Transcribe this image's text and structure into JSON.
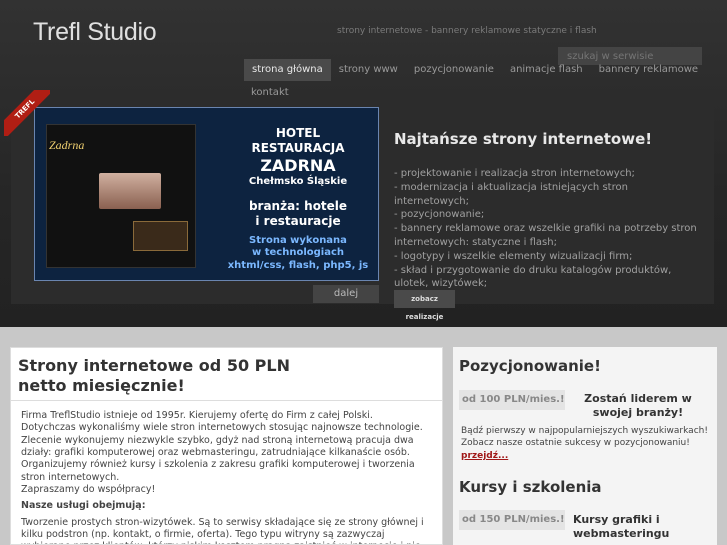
{
  "header": {
    "logo": "Trefl Studio",
    "tagline": "strony internetowe - bannery reklamowe statyczne i flash",
    "search_placeholder": "szukaj w serwisie"
  },
  "nav": {
    "items": [
      "strona główna",
      "strony www",
      "pozycjonowanie",
      "animacje flash",
      "bannery reklamowe"
    ],
    "contact": "kontakt",
    "active_index": 0
  },
  "ribbon": {
    "label": "TREFL"
  },
  "slider": {
    "screen_title": "Zadrna",
    "lines": [
      "HOTEL",
      "RESTAURACJA",
      "ZADRNA",
      "Chełmsko Śląskie",
      "branża: hotele",
      "i restauracje",
      "Strona wykonana",
      "w technologiach",
      "xhtml/css, flash, php5, js"
    ],
    "next_label": "dalej"
  },
  "promo": {
    "title": "Najtańsze strony internetowe!",
    "items": [
      "- projektowanie i realizacja stron internetowych;",
      "- modernizacja i aktualizacja istniejących stron internetowych;",
      "- pozycjonowanie;",
      "- bannery reklamowe oraz wszelkie grafiki na potrzeby stron internetowych: statyczne i flash;",
      "- logotypy i wszelkie elementy wizualizacji firm;",
      "- skład i przygotowanie do druku katalogów produktów, ulotek, wizytówek;"
    ],
    "see_label": "zobacz realizacje"
  },
  "main": {
    "title": "Strony internetowe od 50 PLN netto miesięcznie!",
    "intro": "Firma TreflStudio istnieje od 1995r. Kierujemy ofertę do Firm z całej Polski. Dotychczas wykonaliśmy wiele stron internetowych stosując najnowsze technologie. Zlecenie wykonujemy niezwykle szybko, gdyż nad stroną internetową pracuja dwa działy: grafiki komputerowej oraz webmasteringu, zatrudniające kilkanaście osób.",
    "courses": "Organizujemy również kursy i szkolenia z zakresu grafiki komputerowej i tworzenia stron internetowych.",
    "invite": "Zapraszamy do współpracy!",
    "services_heading": "Nasze usługi obejmują:",
    "services_text": "Tworzenie prostych stron-wizytówek. Są to serwisy składające się ze strony głównej i kilku podstron (np. kontakt, o firmie, oferta). Tego typu witryny są zazwyczaj wybierane przez klientów, którzy niskim kosztem pragną zaistnieć w internecie i nie"
  },
  "sidebar": {
    "positioning": {
      "title": "Pozycjonowanie!",
      "price": "od 100 PLN/mies.!",
      "highlight": "Zostań liderem w swojej branży!",
      "text": "Bądź pierwszy w najpopularniejszych wyszukiwarkach! Zobacz nasze ostatnie sukcesy w pozycjonowaniu!",
      "link": "przejdź..."
    },
    "courses": {
      "title": "Kursy i szkolenia",
      "price": "od 150 PLN/mies.!",
      "highlight": "Kursy grafiki i webmasteringu"
    }
  }
}
